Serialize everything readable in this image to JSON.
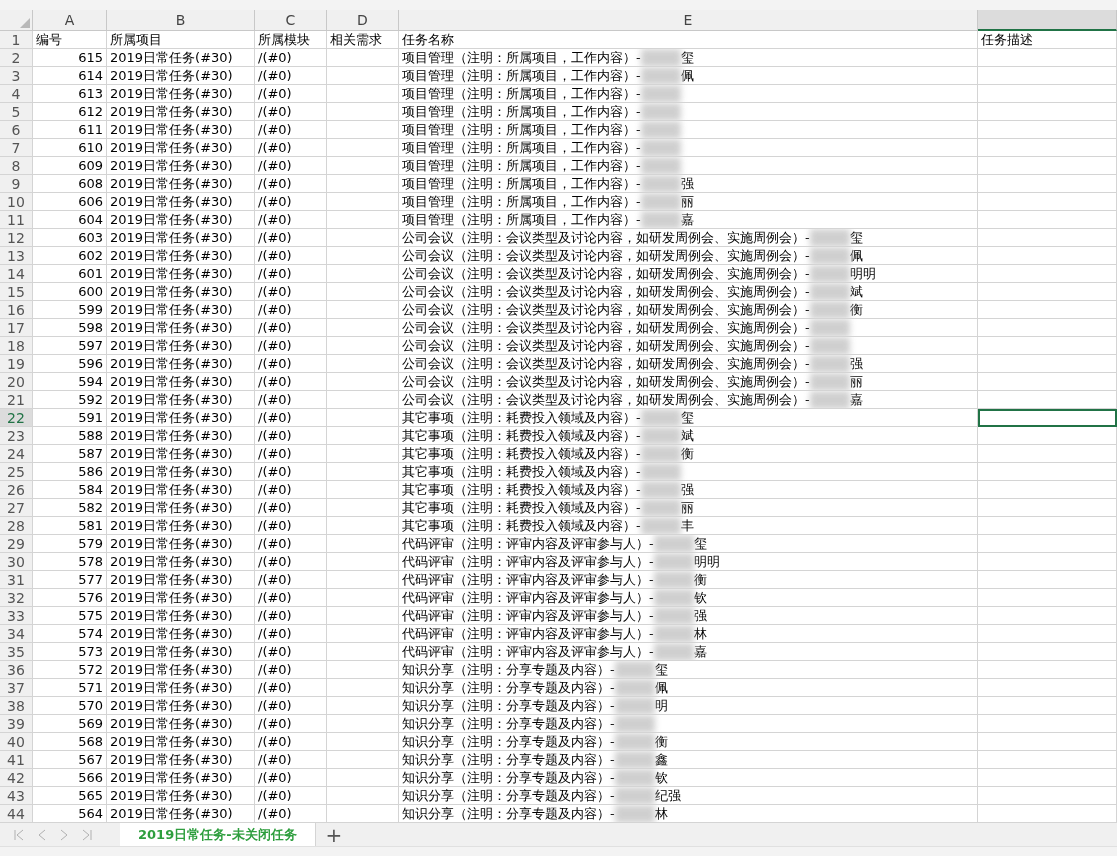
{
  "columns": [
    {
      "letter": "A",
      "selected": false
    },
    {
      "letter": "B",
      "selected": false
    },
    {
      "letter": "C",
      "selected": false
    },
    {
      "letter": "D",
      "selected": false
    },
    {
      "letter": "E",
      "selected": false
    },
    {
      "selected": true
    }
  ],
  "header_row": {
    "number": "1",
    "cells": [
      "编号",
      "所属项目",
      "所属模块",
      "相关需求",
      "任务名称",
      "任务描述"
    ]
  },
  "rows": [
    {
      "number": "2",
      "id": "615",
      "project": "2019日常任务(#30)",
      "module": "/(#0)",
      "task": "项目管理（注明：所属项目，工作内容）-",
      "tail": "玺",
      "selected": false
    },
    {
      "number": "3",
      "id": "614",
      "project": "2019日常任务(#30)",
      "module": "/(#0)",
      "task": "项目管理（注明：所属项目，工作内容）-",
      "tail": "佩",
      "selected": false
    },
    {
      "number": "4",
      "id": "613",
      "project": "2019日常任务(#30)",
      "module": "/(#0)",
      "task": "项目管理（注明：所属项目，工作内容）-",
      "selected": false
    },
    {
      "number": "5",
      "id": "612",
      "project": "2019日常任务(#30)",
      "module": "/(#0)",
      "task": "项目管理（注明：所属项目，工作内容）-",
      "selected": false
    },
    {
      "number": "6",
      "id": "611",
      "project": "2019日常任务(#30)",
      "module": "/(#0)",
      "task": "项目管理（注明：所属项目，工作内容）-",
      "selected": false
    },
    {
      "number": "7",
      "id": "610",
      "project": "2019日常任务(#30)",
      "module": "/(#0)",
      "task": "项目管理（注明：所属项目，工作内容）-",
      "selected": false
    },
    {
      "number": "8",
      "id": "609",
      "project": "2019日常任务(#30)",
      "module": "/(#0)",
      "task": "项目管理（注明：所属项目，工作内容）-",
      "selected": false
    },
    {
      "number": "9",
      "id": "608",
      "project": "2019日常任务(#30)",
      "module": "/(#0)",
      "task": "项目管理（注明：所属项目，工作内容）-",
      "tail": "强",
      "selected": false
    },
    {
      "number": "10",
      "id": "606",
      "project": "2019日常任务(#30)",
      "module": "/(#0)",
      "task": "项目管理（注明：所属项目，工作内容）-",
      "tail": "丽",
      "selected": false
    },
    {
      "number": "11",
      "id": "604",
      "project": "2019日常任务(#30)",
      "module": "/(#0)",
      "task": "项目管理（注明：所属项目，工作内容）-",
      "tail": "嘉",
      "selected": false
    },
    {
      "number": "12",
      "id": "603",
      "project": "2019日常任务(#30)",
      "module": "/(#0)",
      "task": "公司会议（注明：会议类型及讨论内容，如研发周例会、实施周例会）-",
      "tail": "玺",
      "selected": false
    },
    {
      "number": "13",
      "id": "602",
      "project": "2019日常任务(#30)",
      "module": "/(#0)",
      "task": "公司会议（注明：会议类型及讨论内容，如研发周例会、实施周例会）-",
      "tail": "佩",
      "selected": false
    },
    {
      "number": "14",
      "id": "601",
      "project": "2019日常任务(#30)",
      "module": "/(#0)",
      "task": "公司会议（注明：会议类型及讨论内容，如研发周例会、实施周例会）-",
      "tail": "明明",
      "selected": false
    },
    {
      "number": "15",
      "id": "600",
      "project": "2019日常任务(#30)",
      "module": "/(#0)",
      "task": "公司会议（注明：会议类型及讨论内容，如研发周例会、实施周例会）-",
      "tail": "斌",
      "selected": false
    },
    {
      "number": "16",
      "id": "599",
      "project": "2019日常任务(#30)",
      "module": "/(#0)",
      "task": "公司会议（注明：会议类型及讨论内容，如研发周例会、实施周例会）-",
      "tail": "衡",
      "selected": false
    },
    {
      "number": "17",
      "id": "598",
      "project": "2019日常任务(#30)",
      "module": "/(#0)",
      "task": "公司会议（注明：会议类型及讨论内容，如研发周例会、实施周例会）-",
      "selected": false
    },
    {
      "number": "18",
      "id": "597",
      "project": "2019日常任务(#30)",
      "module": "/(#0)",
      "task": "公司会议（注明：会议类型及讨论内容，如研发周例会、实施周例会）-",
      "selected": false
    },
    {
      "number": "19",
      "id": "596",
      "project": "2019日常任务(#30)",
      "module": "/(#0)",
      "task": "公司会议（注明：会议类型及讨论内容，如研发周例会、实施周例会）-",
      "tail": "强",
      "selected": false
    },
    {
      "number": "20",
      "id": "594",
      "project": "2019日常任务(#30)",
      "module": "/(#0)",
      "task": "公司会议（注明：会议类型及讨论内容，如研发周例会、实施周例会）-",
      "tail": "丽",
      "selected": false
    },
    {
      "number": "21",
      "id": "592",
      "project": "2019日常任务(#30)",
      "module": "/(#0)",
      "task": "公司会议（注明：会议类型及讨论内容，如研发周例会、实施周例会）-",
      "tail": "嘉",
      "selected": false
    },
    {
      "number": "22",
      "id": "591",
      "project": "2019日常任务(#30)",
      "module": "/(#0)",
      "task": "其它事项（注明：耗费投入领域及内容）-",
      "tail": "玺",
      "selected": true
    },
    {
      "number": "23",
      "id": "588",
      "project": "2019日常任务(#30)",
      "module": "/(#0)",
      "task": "其它事项（注明：耗费投入领域及内容）-",
      "tail": "斌",
      "selected": false
    },
    {
      "number": "24",
      "id": "587",
      "project": "2019日常任务(#30)",
      "module": "/(#0)",
      "task": "其它事项（注明：耗费投入领域及内容）-",
      "tail": "衡",
      "selected": false
    },
    {
      "number": "25",
      "id": "586",
      "project": "2019日常任务(#30)",
      "module": "/(#0)",
      "task": "其它事项（注明：耗费投入领域及内容）-",
      "selected": false
    },
    {
      "number": "26",
      "id": "584",
      "project": "2019日常任务(#30)",
      "module": "/(#0)",
      "task": "其它事项（注明：耗费投入领域及内容）-",
      "tail": "强",
      "selected": false
    },
    {
      "number": "27",
      "id": "582",
      "project": "2019日常任务(#30)",
      "module": "/(#0)",
      "task": "其它事项（注明：耗费投入领域及内容）-",
      "tail": "丽",
      "selected": false
    },
    {
      "number": "28",
      "id": "581",
      "project": "2019日常任务(#30)",
      "module": "/(#0)",
      "task": "其它事项（注明：耗费投入领域及内容）-",
      "tail": "丰",
      "selected": false
    },
    {
      "number": "29",
      "id": "579",
      "project": "2019日常任务(#30)",
      "module": "/(#0)",
      "task": "代码评审（注明：评审内容及评审参与人）-",
      "tail": "玺",
      "selected": false
    },
    {
      "number": "30",
      "id": "578",
      "project": "2019日常任务(#30)",
      "module": "/(#0)",
      "task": "代码评审（注明：评审内容及评审参与人）-",
      "tail": "明明",
      "selected": false
    },
    {
      "number": "31",
      "id": "577",
      "project": "2019日常任务(#30)",
      "module": "/(#0)",
      "task": "代码评审（注明：评审内容及评审参与人）-",
      "tail": "衡",
      "selected": false
    },
    {
      "number": "32",
      "id": "576",
      "project": "2019日常任务(#30)",
      "module": "/(#0)",
      "task": "代码评审（注明：评审内容及评审参与人）-",
      "tail": "钦",
      "selected": false
    },
    {
      "number": "33",
      "id": "575",
      "project": "2019日常任务(#30)",
      "module": "/(#0)",
      "task": "代码评审（注明：评审内容及评审参与人）-",
      "tail": "强",
      "selected": false
    },
    {
      "number": "34",
      "id": "574",
      "project": "2019日常任务(#30)",
      "module": "/(#0)",
      "task": "代码评审（注明：评审内容及评审参与人）-",
      "tail": "林",
      "selected": false
    },
    {
      "number": "35",
      "id": "573",
      "project": "2019日常任务(#30)",
      "module": "/(#0)",
      "task": "代码评审（注明：评审内容及评审参与人）-",
      "tail": "嘉",
      "selected": false
    },
    {
      "number": "36",
      "id": "572",
      "project": "2019日常任务(#30)",
      "module": "/(#0)",
      "task": "知识分享（注明：分享专题及内容）-",
      "tail": "玺",
      "selected": false
    },
    {
      "number": "37",
      "id": "571",
      "project": "2019日常任务(#30)",
      "module": "/(#0)",
      "task": "知识分享（注明：分享专题及内容）-",
      "tail": "佩",
      "selected": false
    },
    {
      "number": "38",
      "id": "570",
      "project": "2019日常任务(#30)",
      "module": "/(#0)",
      "task": "知识分享（注明：分享专题及内容）-",
      "tail": "明",
      "selected": false
    },
    {
      "number": "39",
      "id": "569",
      "project": "2019日常任务(#30)",
      "module": "/(#0)",
      "task": "知识分享（注明：分享专题及内容）-",
      "selected": false
    },
    {
      "number": "40",
      "id": "568",
      "project": "2019日常任务(#30)",
      "module": "/(#0)",
      "task": "知识分享（注明：分享专题及内容）-",
      "tail": "衡",
      "selected": false
    },
    {
      "number": "41",
      "id": "567",
      "project": "2019日常任务(#30)",
      "module": "/(#0)",
      "task": "知识分享（注明：分享专题及内容）-",
      "tail": "鑫",
      "selected": false
    },
    {
      "number": "42",
      "id": "566",
      "project": "2019日常任务(#30)",
      "module": "/(#0)",
      "task": "知识分享（注明：分享专题及内容）-",
      "tail": "钦",
      "selected": false
    },
    {
      "number": "43",
      "id": "565",
      "project": "2019日常任务(#30)",
      "module": "/(#0)",
      "task": "知识分享（注明：分享专题及内容）-",
      "tail": "纪强",
      "selected": false
    },
    {
      "number": "44",
      "id": "564",
      "project": "2019日常任务(#30)",
      "module": "/(#0)",
      "task": "知识分享（注明：分享专题及内容）-",
      "tail": "林",
      "selected": false
    }
  ],
  "sheet_tabs": [
    {
      "label": "2019日常任务-未关闭任务",
      "selected": true
    }
  ],
  "add_sheet": "+"
}
